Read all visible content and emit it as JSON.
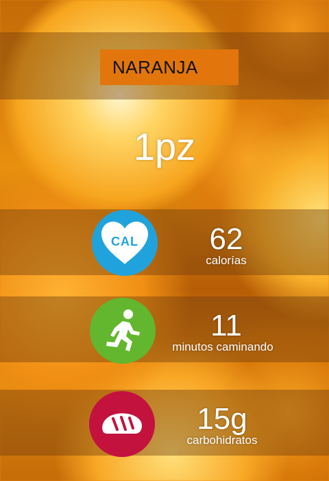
{
  "title": "NARANJA",
  "quantity": "1pz",
  "colors": {
    "title_box": "#e2760c",
    "calories_icon": "#20a3dd",
    "walk_icon": "#62b72e",
    "carbs_icon": "#c2123d"
  },
  "stats": [
    {
      "icon": "heart-cal-icon",
      "icon_text": "CAL",
      "value": "62",
      "label": "calorías"
    },
    {
      "icon": "running-person-icon",
      "value": "11",
      "label": "minutos caminando"
    },
    {
      "icon": "bread-icon",
      "value": "15g",
      "label": "carbohidratos"
    }
  ]
}
